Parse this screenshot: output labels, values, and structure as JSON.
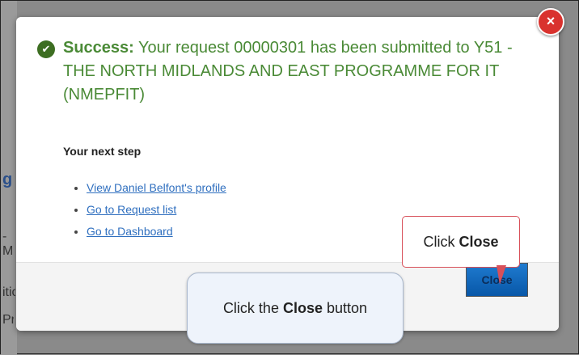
{
  "background": {
    "fragments": [
      "g",
      "-M",
      "itio",
      "Pr"
    ]
  },
  "modal": {
    "close_icon": "×",
    "success_label": "Success:",
    "message": "Your request 00000301 has been submitted to Y51 - THE NORTH MIDLANDS AND EAST PROGRAMME FOR IT (NMEPFIT)",
    "next_step_heading": "Your next step",
    "links": [
      {
        "label": "View Daniel Belfont's profile"
      },
      {
        "label": "Go to Request list"
      },
      {
        "label": "Go to Dashboard"
      }
    ],
    "close_button": "Close"
  },
  "callouts": {
    "small": {
      "prefix": "Click ",
      "bold": "Close"
    },
    "large": {
      "prefix": "Click the ",
      "bold": "Close",
      "suffix": " button"
    }
  },
  "colors": {
    "success": "#4a8a36",
    "close_x": "#d9322e",
    "button": "#0f68bd",
    "link": "#2f6fbf"
  }
}
